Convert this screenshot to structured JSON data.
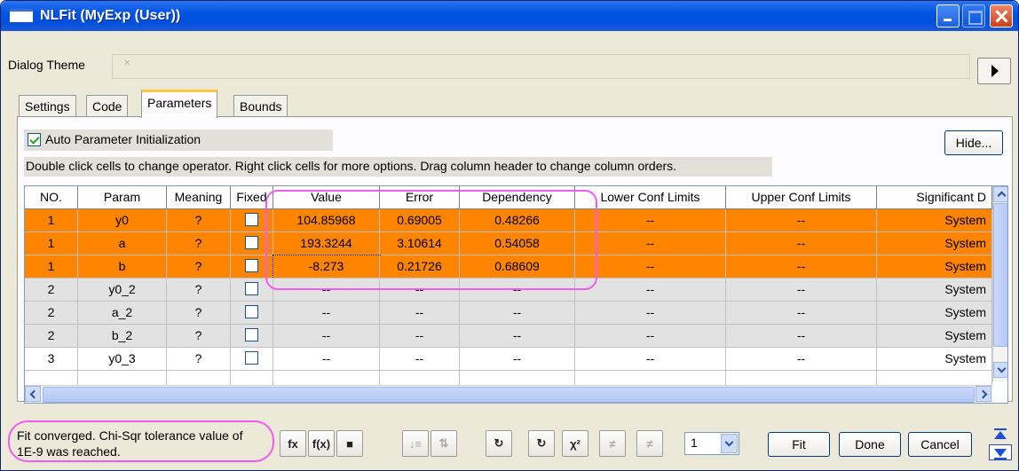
{
  "window": {
    "title": "NLFit (MyExp (User))"
  },
  "theme": {
    "label": "Dialog Theme"
  },
  "tabs": [
    {
      "label": "Settings"
    },
    {
      "label": "Code"
    },
    {
      "label": "Parameters",
      "active": true
    },
    {
      "label": "Bounds"
    }
  ],
  "params_panel": {
    "auto_init_label": "Auto Parameter Initialization",
    "auto_init_checked": true,
    "hide_button": "Hide...",
    "instructions": "Double click cells to change operator. Right click cells for more options. Drag column header to change column orders."
  },
  "table": {
    "columns": [
      "NO.",
      "Param",
      "Meaning",
      "Fixed",
      "Value",
      "Error",
      "Dependency",
      "Lower Conf Limits",
      "Upper Conf Limits",
      "Significant D"
    ],
    "rows": [
      {
        "no": "1",
        "param": "y0",
        "meaning": "?",
        "value": "104.85968",
        "error": "0.69005",
        "dependency": "0.48266",
        "lower": "--",
        "upper": "--",
        "sig": "System",
        "style": "orange"
      },
      {
        "no": "1",
        "param": "a",
        "meaning": "?",
        "value": "193.3244",
        "error": "3.10614",
        "dependency": "0.54058",
        "lower": "--",
        "upper": "--",
        "sig": "System",
        "style": "orange"
      },
      {
        "no": "1",
        "param": "b",
        "meaning": "?",
        "value": "-8.273",
        "error": "0.21726",
        "dependency": "0.68609",
        "lower": "--",
        "upper": "--",
        "sig": "System",
        "style": "orange"
      },
      {
        "no": "2",
        "param": "y0_2",
        "meaning": "?",
        "value": "--",
        "error": "--",
        "dependency": "--",
        "lower": "--",
        "upper": "--",
        "sig": "System",
        "style": "gray"
      },
      {
        "no": "2",
        "param": "a_2",
        "meaning": "?",
        "value": "--",
        "error": "--",
        "dependency": "--",
        "lower": "--",
        "upper": "--",
        "sig": "System",
        "style": "gray"
      },
      {
        "no": "2",
        "param": "b_2",
        "meaning": "?",
        "value": "--",
        "error": "--",
        "dependency": "--",
        "lower": "--",
        "upper": "--",
        "sig": "System",
        "style": "gray"
      },
      {
        "no": "3",
        "param": "y0_3",
        "meaning": "?",
        "value": "--",
        "error": "--",
        "dependency": "--",
        "lower": "--",
        "upper": "--",
        "sig": "System",
        "style": "white"
      }
    ]
  },
  "footer": {
    "status": "Fit converged. Chi-Sqr tolerance value of 1E-9 was reached.",
    "icons": [
      {
        "name": "initialize-icon",
        "glyph": "fx",
        "disabled": false
      },
      {
        "name": "function-icon",
        "glyph": "f(x)",
        "disabled": false
      },
      {
        "name": "save-icon",
        "glyph": "■",
        "disabled": false
      },
      {
        "name": "sort-icon",
        "glyph": "↓≡",
        "disabled": true
      },
      {
        "name": "move-icon",
        "glyph": "⇅",
        "disabled": true
      },
      {
        "name": "one-iteration-icon",
        "glyph": "↻",
        "disabled": false
      },
      {
        "name": "fit-until-converged-icon",
        "glyph": "↻",
        "disabled": false
      },
      {
        "name": "chi-square-icon",
        "glyph": "χ²",
        "disabled": false
      },
      {
        "name": "step-forward-icon",
        "glyph": "≠",
        "disabled": true
      },
      {
        "name": "step-end-icon",
        "glyph": "≠",
        "disabled": true
      }
    ],
    "iteration_value": "1",
    "fit_button": "Fit",
    "done_button": "Done",
    "cancel_button": "Cancel"
  },
  "colors": {
    "selected_row": "#ff8400",
    "shared_row": "#e2e2e2",
    "annotation": "#f05cf0"
  }
}
